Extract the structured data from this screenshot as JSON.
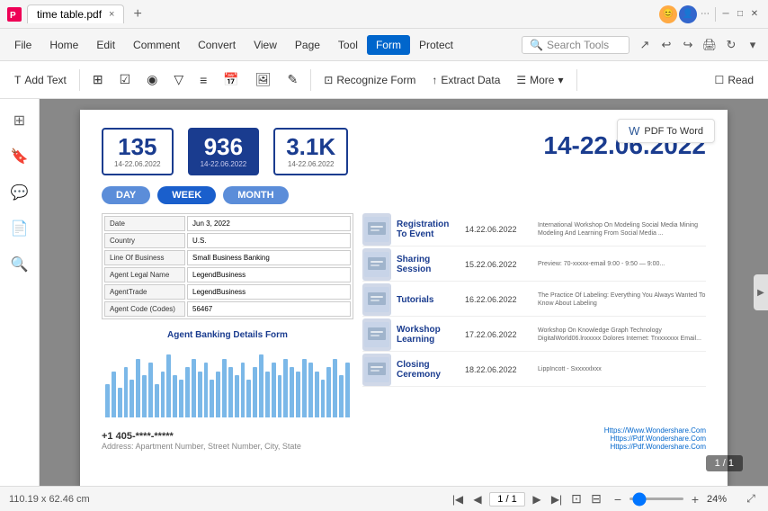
{
  "titlebar": {
    "filename": "time table.pdf",
    "close_tab": "×",
    "new_tab": "+"
  },
  "menubar": {
    "file": "File",
    "home": "Home",
    "edit": "Edit",
    "comment": "Comment",
    "convert": "Convert",
    "view": "View",
    "page": "Page",
    "tool": "Tool",
    "form": "Form",
    "protect": "Protect",
    "search_placeholder": "Search Tools"
  },
  "toolbar": {
    "add_text": "Add Text",
    "fields": "",
    "checkbox": "",
    "radio": "",
    "dropdown": "",
    "list": "",
    "date": "",
    "image": "",
    "sign": "",
    "recognize_form": "Recognize Form",
    "extract_data": "Extract Data",
    "more": "More",
    "read": "Read"
  },
  "document": {
    "pdf_to_word": "PDF To Word",
    "stats": [
      {
        "number": "135",
        "date": "14-22.06.2022"
      },
      {
        "number": "936",
        "date": "14-22.06.2022",
        "active": true
      },
      {
        "number": "3.1K",
        "date": "14-22.06.2022"
      }
    ],
    "date_range": "14-22.06.2022",
    "periods": [
      "DAY",
      "WEEK",
      "MONTH"
    ],
    "active_period": "WEEK",
    "form_fields": [
      {
        "label": "Date",
        "value": "Jun 3, 2022"
      },
      {
        "label": "Country",
        "value": "U.S."
      },
      {
        "label": "Line Of Business",
        "value": "Small Business Banking"
      },
      {
        "label": "Agent Legal Name",
        "value": "LegendBusiness"
      },
      {
        "label": "AgentTrade",
        "value": "LegendBusiness"
      },
      {
        "label": "Agent Code (Codes)",
        "value": "56467"
      }
    ],
    "chart_title": "Agent Banking Details Form",
    "chart_bars": [
      40,
      55,
      35,
      60,
      45,
      70,
      50,
      65,
      40,
      55,
      75,
      50,
      45,
      60,
      70,
      55,
      65,
      45,
      55,
      70,
      60,
      50,
      65,
      45,
      60,
      75,
      55,
      65,
      50,
      70,
      60,
      55,
      70,
      65,
      55,
      45,
      60,
      70,
      50,
      65
    ],
    "schedule": [
      {
        "name": "Registration To Event",
        "date": "14.22.06.2022",
        "detail": "International Workshop On Modeling Social Media Mining Modeling And Learning From Social Media ..."
      },
      {
        "name": "Sharing Session",
        "date": "15.22.06.2022",
        "detail": "Preview: 70-xxxxx-email 9:00 - 9:50 — 9:00..."
      },
      {
        "name": "Tutorials",
        "date": "16.22.06.2022",
        "detail": "The Practice Of Labeling: Everything You Always Wanted To Know About Labeling"
      },
      {
        "name": "Workshop Learning",
        "date": "17.22.06.2022",
        "detail": "Workshop On Knowledge Graph Technology DigitalWorld06.lnxxxxx Dolores Internet: Trxxxxxxx Email..."
      },
      {
        "name": "Closing Ceremony",
        "date": "18.22.06.2022",
        "detail": "LippIncott - Sxxxxxlxxx"
      }
    ],
    "phone": "+1 405-****-*****",
    "address": "Address: Apartment Number, Street Number, City, State",
    "urls": [
      "Https://Www.Wondershare.Com",
      "Https://Pdf.Wondershare.Com",
      "Https://Pdf.Wondershare.Com"
    ]
  },
  "bottombar": {
    "page_size": "110.19 x 62.46 cm",
    "current_page": "1",
    "total_pages": "1",
    "page_display": "1 / 1",
    "zoom_level": "24%"
  }
}
